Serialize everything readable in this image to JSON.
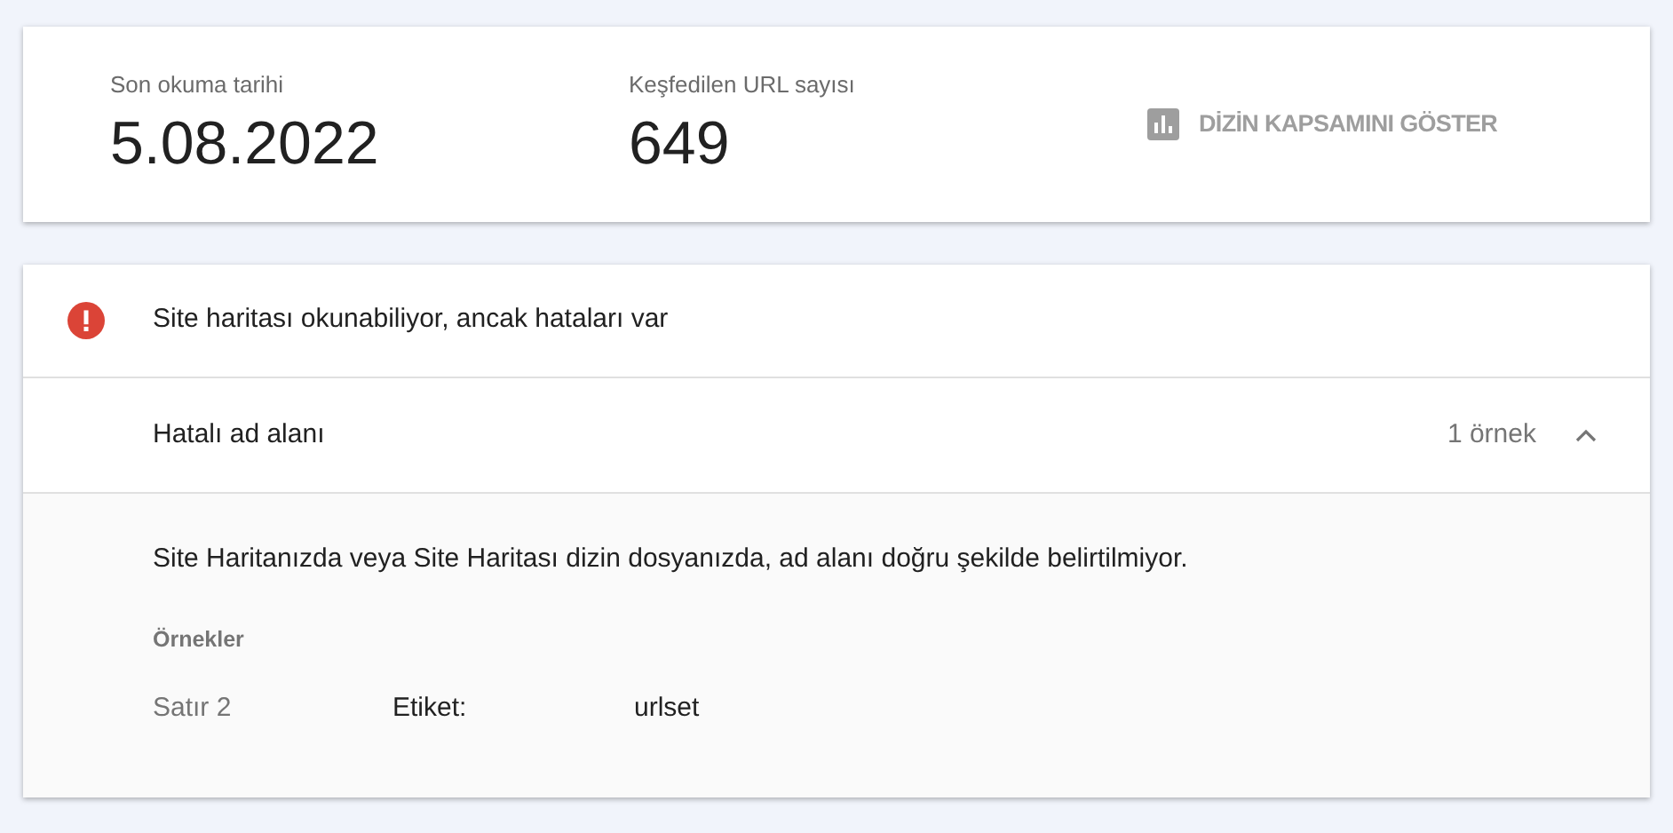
{
  "stats": [
    {
      "label": "Son okuma tarihi",
      "value": "5.08.2022"
    },
    {
      "label": "Keşfedilen URL sayısı",
      "value": "649"
    }
  ],
  "coverage_button": {
    "label": "DİZİN KAPSAMINI GÖSTER"
  },
  "status": {
    "kind": "error",
    "message": "Site haritası okunabiliyor, ancak hataları var"
  },
  "issues": [
    {
      "title": "Hatalı ad alanı",
      "count": "1 örnek",
      "expanded": true,
      "description": "Site Haritanızda veya Site Haritası dizin dosyanızda, ad alanı doğru şekilde belirtilmiyor.",
      "examples_heading": "Örnekler",
      "examples": [
        {
          "line": "Satır 2",
          "tag_label": "Etiket:",
          "tag_value": "urlset"
        }
      ]
    }
  ]
}
